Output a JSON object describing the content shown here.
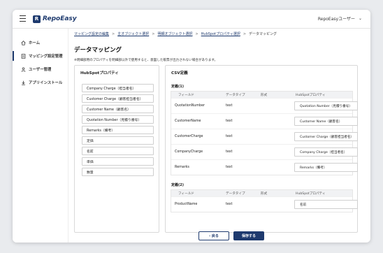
{
  "header": {
    "logo_mark": "R",
    "logo_text": "RepoEasy",
    "user_label": "RepoEasyユーザー",
    "chevron": "⌄"
  },
  "sidebar": {
    "items": [
      {
        "label": "ホーム",
        "icon": "home-icon",
        "active": false
      },
      {
        "label": "マッピング設定管理",
        "icon": "mapping-icon",
        "active": true
      },
      {
        "label": "ユーザー管理",
        "icon": "user-icon",
        "active": false
      },
      {
        "label": "アプリインストール",
        "icon": "download-icon",
        "active": false
      }
    ]
  },
  "breadcrumb": {
    "items": [
      "マッピング設定の編集",
      "主オブジェクト選択",
      "明細オブジェクト選択",
      "HubSpotプロパティ選択"
    ],
    "current": "データマッピング",
    "separator": ">"
  },
  "page": {
    "title": "データマッピング",
    "note": "※明細部用のプロパティを明細部以外で使用すると、意図した帳票が出力されない場合があります。"
  },
  "hubspot_panel": {
    "title": "HubSpotプロパティ",
    "chips": [
      "Company Charge（担当者名）",
      "Customer Charge（顧客担当者名）",
      "Customer Name（顧客名）",
      "Quotation Number（見積り番号）",
      "Remarks（備考）",
      "定価",
      "名前",
      "単価",
      "数量"
    ]
  },
  "csv_panel": {
    "title": "CSV定義",
    "columns": [
      "フィールド",
      "データタイプ",
      "形式",
      "HubSpotプロパティ"
    ],
    "sections": [
      {
        "label": "定義(1)",
        "rows": [
          {
            "field": "QuotationNumber",
            "type": "text",
            "format": "",
            "mapped": "Quotation Number（見積り番号）"
          },
          {
            "field": "CustomerName",
            "type": "text",
            "format": "",
            "mapped": "Customer Name（顧客名）"
          },
          {
            "field": "CustomerCharge",
            "type": "text",
            "format": "",
            "mapped": "Customer Charge（顧客担当者名）"
          },
          {
            "field": "CompanyCharge",
            "type": "text",
            "format": "",
            "mapped": "Company Charge（担当者名）"
          },
          {
            "field": "Remarks",
            "type": "text",
            "format": "",
            "mapped": "Remarks（備考）"
          }
        ]
      },
      {
        "label": "定義(2)",
        "rows": [
          {
            "field": "ProductName",
            "type": "text",
            "format": "",
            "mapped": "名前"
          }
        ]
      }
    ]
  },
  "actions": {
    "back_label": "‹ 戻る",
    "save_label": "保存する"
  }
}
